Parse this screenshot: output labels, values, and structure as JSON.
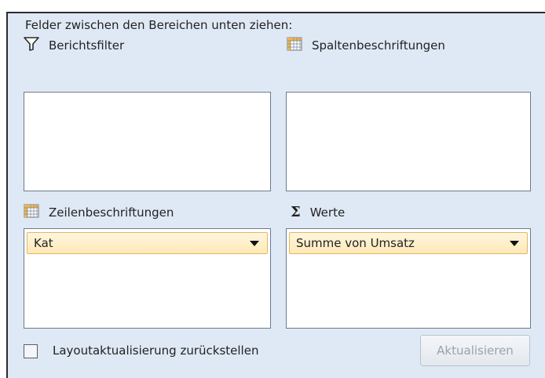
{
  "instruction": "Felder zwischen den Bereichen unten ziehen:",
  "areas": {
    "report_filter": {
      "label": "Berichtsfilter",
      "icon": "filter-icon"
    },
    "column_labels": {
      "label": "Spaltenbeschriftungen",
      "icon": "table-grid-icon"
    },
    "row_labels": {
      "label": "Zeilenbeschriftungen",
      "icon": "table-grid-icon",
      "fields": [
        "Kat"
      ]
    },
    "values": {
      "label": "Werte",
      "icon": "sigma-icon",
      "symbol": "Σ",
      "fields": [
        "Summe von Umsatz"
      ]
    }
  },
  "defer_update": {
    "label": "Layoutaktualisierung zurückstellen",
    "checked": false
  },
  "update_button": {
    "label": "Aktualisieren",
    "enabled": false
  },
  "colors": {
    "panel": "#dfe9f5",
    "field_fill": "#ffe9b6",
    "field_border": "#e3b664"
  }
}
